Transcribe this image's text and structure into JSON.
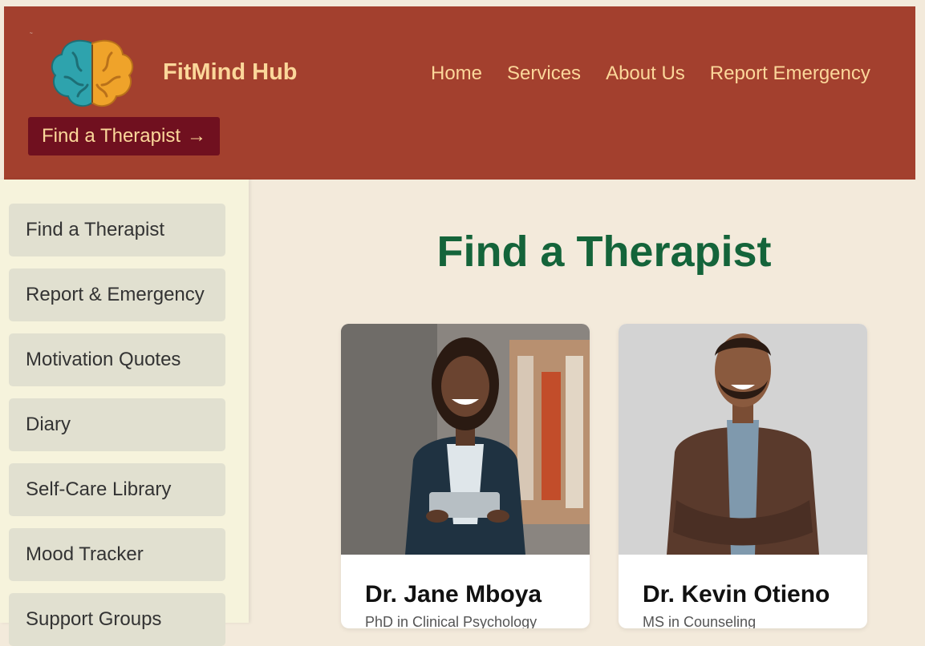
{
  "header": {
    "brand": "FitMind Hub",
    "nav": [
      "Home",
      "Services",
      "About Us",
      "Report Emergency"
    ],
    "cta_label": "Find a Therapist",
    "cta_arrow": "→"
  },
  "sidebar": {
    "items": [
      {
        "label": "Find a Therapist"
      },
      {
        "label": "Report & Emergency"
      },
      {
        "label": "Motivation Quotes"
      },
      {
        "label": "Diary"
      },
      {
        "label": "Self-Care Library"
      },
      {
        "label": "Mood Tracker"
      },
      {
        "label": "Support Groups"
      }
    ]
  },
  "main": {
    "title": "Find a Therapist",
    "therapists": [
      {
        "name": "Dr. Jane Mboya",
        "credential": "PhD in Clinical Psychology"
      },
      {
        "name": "Dr. Kevin Otieno",
        "credential": "MS in Counseling"
      }
    ]
  },
  "colors": {
    "header_bg": "#a3402e",
    "accent_text": "#fbd79a",
    "cta_bg": "#70101f",
    "title_green": "#14643a",
    "sidebar_item_bg": "#e1e0d0",
    "page_bg": "#f3eadb"
  }
}
